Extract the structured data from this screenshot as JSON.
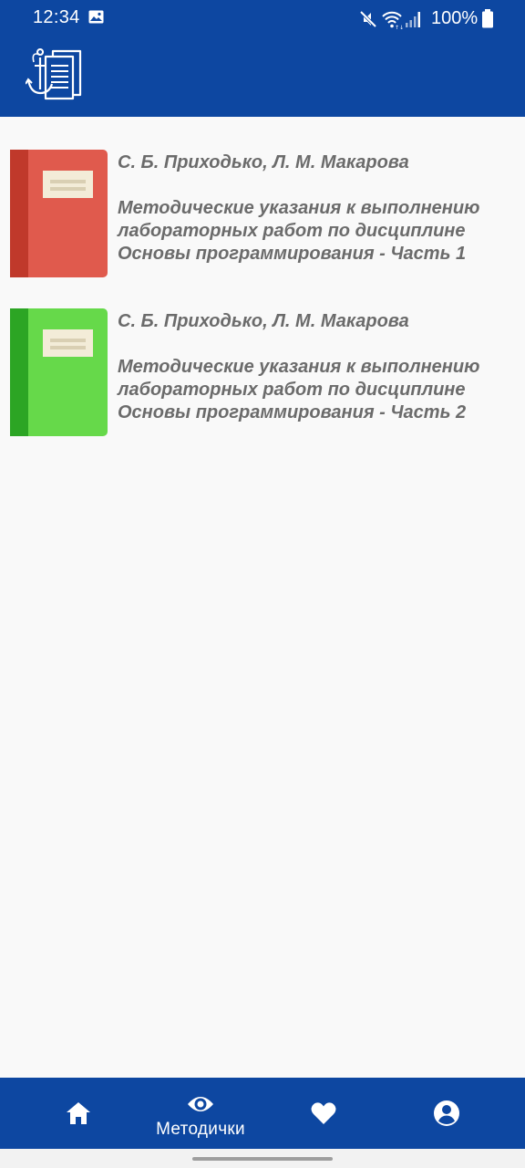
{
  "status_bar": {
    "time": "12:34",
    "battery": "100%",
    "icons": [
      "image-icon",
      "mute-icon",
      "wifi-icon",
      "signal-icon",
      "battery-icon"
    ]
  },
  "app_bar": {
    "logo_icon": "manual-book-logo-icon",
    "background": "#0d47a1"
  },
  "books": [
    {
      "authors": "С. Б. Приходько, Л. М. Макарова",
      "title": "Методические указания к выполнению\nлабораторных работ по дисциплине\nОсновы программирования - Часть 1",
      "cover_color": "#e05a4d",
      "cover_spine_color": "#c0392b"
    },
    {
      "authors": "С. Б. Приходько, Л. М. Макарова",
      "title": "Методические указания к выполнению\nлабораторных работ по дисциплине\nОсновы программирования - Часть 2",
      "cover_color": "#66d94a",
      "cover_spine_color": "#2ca524"
    }
  ],
  "bottom_nav": {
    "items": [
      {
        "icon": "home-icon",
        "label": ""
      },
      {
        "icon": "eye-icon",
        "label": "Методички"
      },
      {
        "icon": "heart-icon",
        "label": ""
      },
      {
        "icon": "account-icon",
        "label": ""
      }
    ],
    "active_index": 1
  }
}
